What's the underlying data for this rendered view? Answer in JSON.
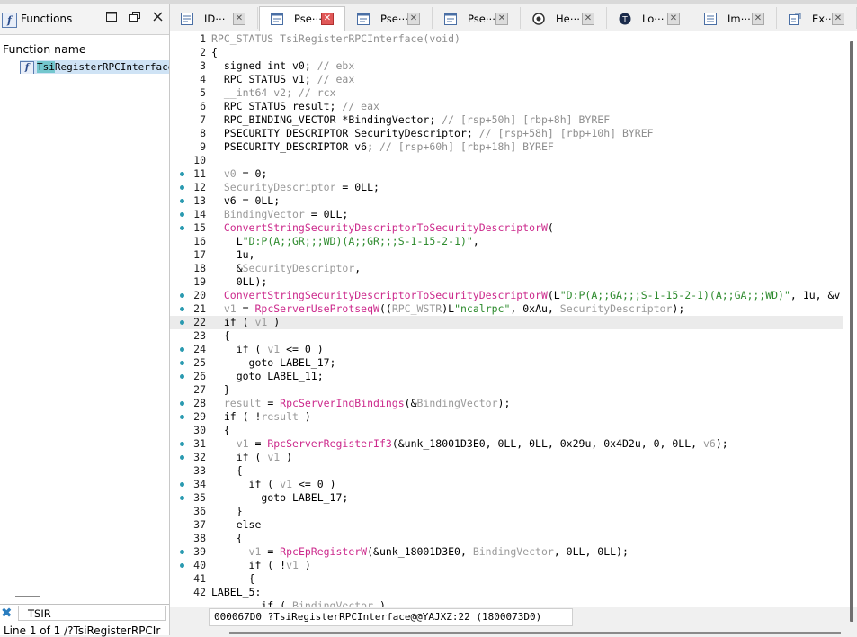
{
  "functions_panel": {
    "title": "Functions",
    "column_header": "Function name",
    "selected_function": {
      "highlight": "Tsi",
      "rest": "RegisterRPCInterface("
    },
    "search_text": "TSIR",
    "status": "Line 1 of 1  /?TsiRegisterRPCIr"
  },
  "tabs": [
    {
      "label": "ID⋯",
      "icon": "ida-view-icon",
      "active": false
    },
    {
      "label": "Pse⋯",
      "icon": "pseudocode-icon",
      "active": true
    },
    {
      "label": "Pse⋯",
      "icon": "pseudocode-icon",
      "active": false
    },
    {
      "label": "Pse⋯",
      "icon": "pseudocode-icon",
      "active": false
    },
    {
      "label": "He⋯",
      "icon": "hex-view-icon",
      "active": false
    },
    {
      "label": "Lo⋯",
      "icon": "local-types-icon",
      "active": false
    },
    {
      "label": "Im⋯",
      "icon": "imports-icon",
      "active": false
    },
    {
      "label": "Ex⋯",
      "icon": "exports-icon",
      "active": false
    }
  ],
  "code_lines": [
    {
      "n": "1",
      "dot": false,
      "seg": [
        [
          "g",
          "RPC_STATUS TsiRegisterRPCInterface(void)"
        ]
      ]
    },
    {
      "n": "2",
      "dot": false,
      "seg": [
        [
          "k",
          "{"
        ]
      ]
    },
    {
      "n": "3",
      "dot": false,
      "seg": [
        [
          "k",
          "  signed int v0; "
        ],
        [
          "g",
          "// ebx"
        ]
      ]
    },
    {
      "n": "4",
      "dot": false,
      "seg": [
        [
          "k",
          "  RPC_STATUS v1; "
        ],
        [
          "g",
          "// eax"
        ]
      ]
    },
    {
      "n": "5",
      "dot": false,
      "seg": [
        [
          "g",
          "  __int64 v2; // rcx"
        ]
      ]
    },
    {
      "n": "6",
      "dot": false,
      "seg": [
        [
          "k",
          "  RPC_STATUS result; "
        ],
        [
          "g",
          "// eax"
        ]
      ]
    },
    {
      "n": "7",
      "dot": false,
      "seg": [
        [
          "k",
          "  RPC_BINDING_VECTOR *BindingVector; "
        ],
        [
          "g",
          "// [rsp+50h] [rbp+8h] BYREF"
        ]
      ]
    },
    {
      "n": "8",
      "dot": false,
      "seg": [
        [
          "k",
          "  PSECURITY_DESCRIPTOR SecurityDescriptor; "
        ],
        [
          "g",
          "// [rsp+58h] [rbp+10h] BYREF"
        ]
      ]
    },
    {
      "n": "9",
      "dot": false,
      "seg": [
        [
          "k",
          "  PSECURITY_DESCRIPTOR v6; "
        ],
        [
          "g",
          "// [rsp+60h] [rbp+18h] BYREF"
        ]
      ]
    },
    {
      "n": "10",
      "dot": false,
      "seg": [
        [
          "k",
          ""
        ]
      ]
    },
    {
      "n": "11",
      "dot": true,
      "seg": [
        [
          "v",
          "  v0"
        ],
        [
          "k",
          " = 0;"
        ]
      ]
    },
    {
      "n": "12",
      "dot": true,
      "seg": [
        [
          "v",
          "  SecurityDescriptor"
        ],
        [
          "k",
          " = 0LL;"
        ]
      ]
    },
    {
      "n": "13",
      "dot": true,
      "seg": [
        [
          "k",
          "  v6 = 0LL;"
        ]
      ]
    },
    {
      "n": "14",
      "dot": true,
      "seg": [
        [
          "v",
          "  BindingVector"
        ],
        [
          "k",
          " = 0LL;"
        ]
      ]
    },
    {
      "n": "15",
      "dot": true,
      "seg": [
        [
          "f",
          "  ConvertStringSecurityDescriptorToSecurityDescriptorW"
        ],
        [
          "k",
          "("
        ]
      ]
    },
    {
      "n": "16",
      "dot": false,
      "seg": [
        [
          "k",
          "    L"
        ],
        [
          "s",
          "\"D:P(A;;GR;;;WD)(A;;GR;;;S-1-15-2-1)\""
        ],
        [
          "k",
          ","
        ]
      ]
    },
    {
      "n": "17",
      "dot": false,
      "seg": [
        [
          "k",
          "    1u,"
        ]
      ]
    },
    {
      "n": "18",
      "dot": false,
      "seg": [
        [
          "k",
          "    &"
        ],
        [
          "v",
          "SecurityDescriptor"
        ],
        [
          "k",
          ","
        ]
      ]
    },
    {
      "n": "19",
      "dot": false,
      "seg": [
        [
          "k",
          "    0LL);"
        ]
      ]
    },
    {
      "n": "20",
      "dot": true,
      "seg": [
        [
          "f",
          "  ConvertStringSecurityDescriptorToSecurityDescriptorW"
        ],
        [
          "k",
          "(L"
        ],
        [
          "s",
          "\"D:P(A;;GA;;;S-1-15-2-1)(A;;GA;;;WD)\""
        ],
        [
          "k",
          ", 1u, &v"
        ]
      ]
    },
    {
      "n": "21",
      "dot": true,
      "seg": [
        [
          "v",
          "  v1"
        ],
        [
          "k",
          " = "
        ],
        [
          "f",
          "RpcServerUseProtseqW"
        ],
        [
          "k",
          "(("
        ],
        [
          "v",
          "RPC_WSTR"
        ],
        [
          "k",
          ")L"
        ],
        [
          "s",
          "\"ncalrpc\""
        ],
        [
          "k",
          ", 0xAu, "
        ],
        [
          "v",
          "SecurityDescriptor"
        ],
        [
          "k",
          ");"
        ]
      ]
    },
    {
      "n": "22",
      "dot": true,
      "cur": true,
      "seg": [
        [
          "k",
          "  if ( "
        ],
        [
          "v",
          "v1"
        ],
        [
          "k",
          " )"
        ]
      ]
    },
    {
      "n": "23",
      "dot": false,
      "seg": [
        [
          "k",
          "  {"
        ]
      ]
    },
    {
      "n": "24",
      "dot": true,
      "seg": [
        [
          "k",
          "    if ( "
        ],
        [
          "v",
          "v1"
        ],
        [
          "k",
          " <= 0 )"
        ]
      ]
    },
    {
      "n": "25",
      "dot": true,
      "seg": [
        [
          "k",
          "      goto LABEL_17;"
        ]
      ]
    },
    {
      "n": "26",
      "dot": true,
      "seg": [
        [
          "k",
          "    goto LABEL_11;"
        ]
      ]
    },
    {
      "n": "27",
      "dot": false,
      "seg": [
        [
          "k",
          "  }"
        ]
      ]
    },
    {
      "n": "28",
      "dot": true,
      "seg": [
        [
          "v",
          "  result"
        ],
        [
          "k",
          " = "
        ],
        [
          "f",
          "RpcServerInqBindings"
        ],
        [
          "k",
          "(&"
        ],
        [
          "v",
          "BindingVector"
        ],
        [
          "k",
          ");"
        ]
      ]
    },
    {
      "n": "29",
      "dot": true,
      "seg": [
        [
          "k",
          "  if ( !"
        ],
        [
          "v",
          "result"
        ],
        [
          "k",
          " )"
        ]
      ]
    },
    {
      "n": "30",
      "dot": false,
      "seg": [
        [
          "k",
          "  {"
        ]
      ]
    },
    {
      "n": "31",
      "dot": true,
      "seg": [
        [
          "v",
          "    v1"
        ],
        [
          "k",
          " = "
        ],
        [
          "f",
          "RpcServerRegisterIf3"
        ],
        [
          "k",
          "(&unk_18001D3E0, 0LL, 0LL, 0x29u, 0x4D2u, 0, 0LL, "
        ],
        [
          "v",
          "v6"
        ],
        [
          "k",
          ");"
        ]
      ]
    },
    {
      "n": "32",
      "dot": true,
      "seg": [
        [
          "k",
          "    if ( "
        ],
        [
          "v",
          "v1"
        ],
        [
          "k",
          " )"
        ]
      ]
    },
    {
      "n": "33",
      "dot": false,
      "seg": [
        [
          "k",
          "    {"
        ]
      ]
    },
    {
      "n": "34",
      "dot": true,
      "seg": [
        [
          "k",
          "      if ( "
        ],
        [
          "v",
          "v1"
        ],
        [
          "k",
          " <= 0 )"
        ]
      ]
    },
    {
      "n": "35",
      "dot": true,
      "seg": [
        [
          "k",
          "        goto LABEL_17;"
        ]
      ]
    },
    {
      "n": "36",
      "dot": false,
      "seg": [
        [
          "k",
          "    }"
        ]
      ]
    },
    {
      "n": "37",
      "dot": false,
      "seg": [
        [
          "k",
          "    else"
        ]
      ]
    },
    {
      "n": "38",
      "dot": false,
      "seg": [
        [
          "k",
          "    {"
        ]
      ]
    },
    {
      "n": "39",
      "dot": true,
      "seg": [
        [
          "v",
          "      v1"
        ],
        [
          "k",
          " = "
        ],
        [
          "f",
          "RpcEpRegisterW"
        ],
        [
          "k",
          "(&unk_18001D3E0, "
        ],
        [
          "v",
          "BindingVector"
        ],
        [
          "k",
          ", 0LL, 0LL);"
        ]
      ]
    },
    {
      "n": "40",
      "dot": true,
      "seg": [
        [
          "k",
          "      if ( !"
        ],
        [
          "v",
          "v1"
        ],
        [
          "k",
          " )"
        ]
      ]
    },
    {
      "n": "41",
      "dot": false,
      "seg": [
        [
          "k",
          "      {"
        ]
      ]
    },
    {
      "n": "42",
      "dot": false,
      "seg": [
        [
          "k",
          "LABEL_5:"
        ]
      ]
    },
    {
      "n": "",
      "dot": false,
      "seg": [
        [
          "k",
          "        if ( "
        ],
        [
          "v",
          "BindingVector"
        ],
        [
          "k",
          " )"
        ]
      ]
    }
  ],
  "address_bar": "000067D0 ?TsiRegisterRPCInterface@@YAJXZ:22 (1800073D0)"
}
